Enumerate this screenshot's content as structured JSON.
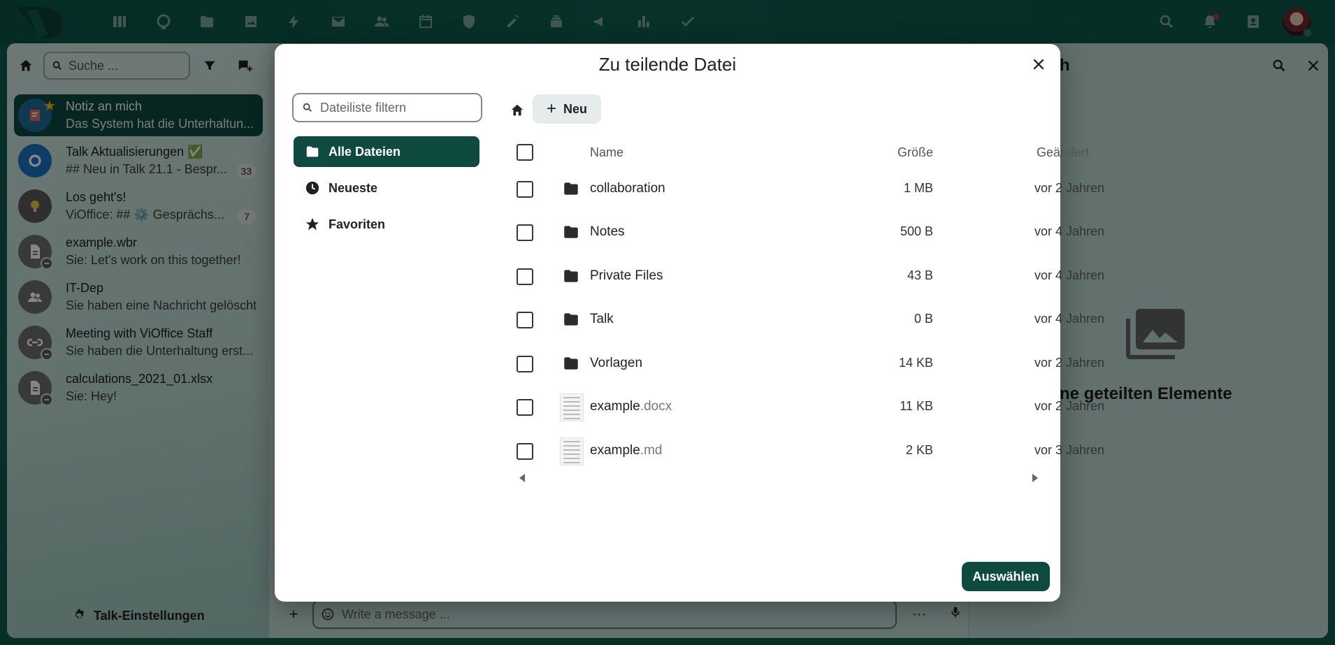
{
  "topbar": {
    "apps": [
      {
        "icon": "dashboard-icon"
      },
      {
        "icon": "talk-icon"
      },
      {
        "icon": "files-icon"
      },
      {
        "icon": "photos-icon"
      },
      {
        "icon": "activity-icon"
      },
      {
        "icon": "mail-icon"
      },
      {
        "icon": "contacts-icon"
      },
      {
        "icon": "calendar-icon"
      },
      {
        "icon": "security-icon"
      },
      {
        "icon": "notes-icon"
      },
      {
        "icon": "deck-icon"
      },
      {
        "icon": "announcements-icon"
      },
      {
        "icon": "analytics-icon"
      },
      {
        "icon": "tasks-icon"
      }
    ],
    "right": [
      "search-icon",
      "notifications-icon",
      "contacts-menu-icon",
      "user-avatar"
    ]
  },
  "left_panel": {
    "search_placeholder": "Suche ...",
    "conversations": [
      {
        "title": "Notiz an mich",
        "subtitle": "Das System hat die Unterhaltun...",
        "active": true,
        "favorite": true
      },
      {
        "title": "Talk Aktualisierungen ✅",
        "subtitle": "## Neu in Talk 21.1 - Bespr...",
        "badge": "33"
      },
      {
        "title": "Los geht's!",
        "subtitle": "ViOffice: ## ⚙️ Gesprächs...",
        "badge": "7"
      },
      {
        "title": "example.wbr",
        "subtitle": "Sie: Let's work on this together!"
      },
      {
        "title": "IT-Dep",
        "subtitle": "Sie haben eine Nachricht gelöscht"
      },
      {
        "title": "Meeting with ViOffice Staff",
        "subtitle": "Sie haben die Unterhaltung erst..."
      },
      {
        "title": "calculations_2021_01.xlsx",
        "subtitle": "Sie: Hey!"
      }
    ],
    "settings_label": "Talk-Einstellungen"
  },
  "composer": {
    "placeholder": "Write a message ...",
    "more_label": "···"
  },
  "right_panel": {
    "title": "ich",
    "empty_text": "eine geteilten Elemente"
  },
  "modal": {
    "title": "Zu teilende Datei",
    "filter_placeholder": "Dateiliste filtern",
    "nav": [
      {
        "label": "Alle Dateien",
        "icon": "folder-icon",
        "active": true
      },
      {
        "label": "Neueste",
        "icon": "clock-icon"
      },
      {
        "label": "Favoriten",
        "icon": "star-icon"
      }
    ],
    "new_label": "Neu",
    "columns": {
      "name": "Name",
      "size": "Größe",
      "modified": "Geändert"
    },
    "files": [
      {
        "name": "collaboration",
        "ext": "",
        "type": "folder",
        "size": "1 MB",
        "modified": "vor 2 Jahren"
      },
      {
        "name": "Notes",
        "ext": "",
        "type": "folder",
        "size": "500 B",
        "modified": "vor 4 Jahren"
      },
      {
        "name": "Private Files",
        "ext": "",
        "type": "folder",
        "size": "43 B",
        "modified": "vor 4 Jahren"
      },
      {
        "name": "Talk",
        "ext": "",
        "type": "folder",
        "size": "0 B",
        "modified": "vor 4 Jahren"
      },
      {
        "name": "Vorlagen",
        "ext": "",
        "type": "folder",
        "size": "14 KB",
        "modified": "vor 2 Jahren"
      },
      {
        "name": "example",
        "ext": ".docx",
        "type": "document",
        "size": "11 KB",
        "modified": "vor 2 Jahren"
      },
      {
        "name": "example",
        "ext": ".md",
        "type": "document",
        "size": "2 KB",
        "modified": "vor 3 Jahren"
      }
    ],
    "select_label": "Auswählen"
  },
  "colors": {
    "brand": "#0e5a4c",
    "accent_dark": "#0e4a40",
    "background_app": "#bcd9d1"
  }
}
